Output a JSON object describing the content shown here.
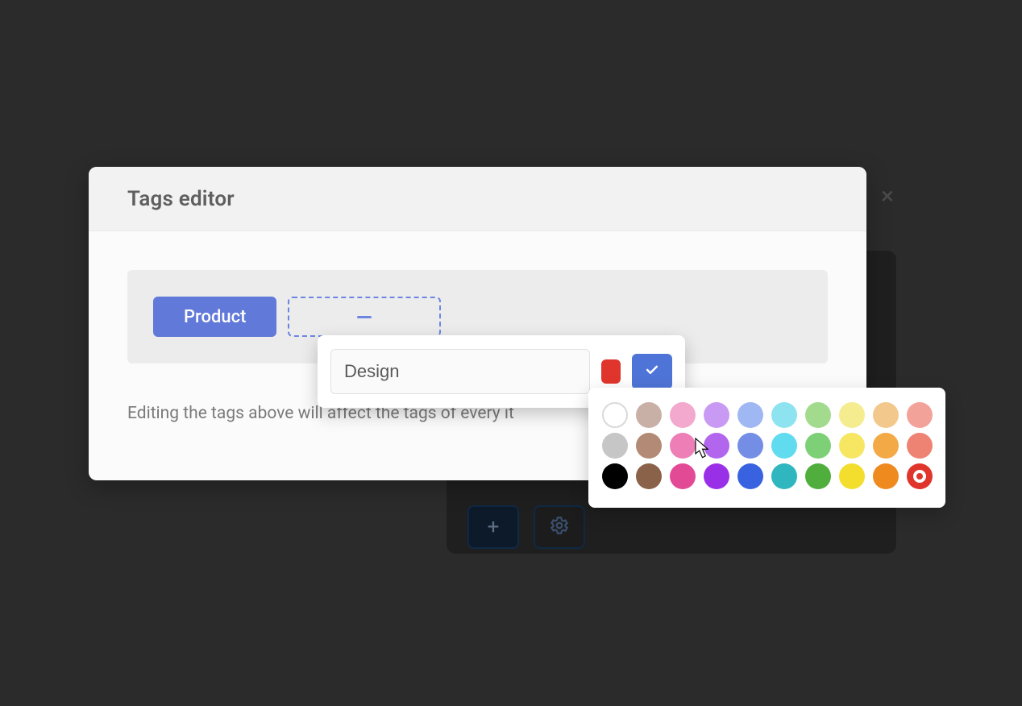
{
  "modal": {
    "title": "Tags editor",
    "existing_tag": "Product",
    "placeholder_label": "",
    "hint": "Editing the tags above will affect the tags of every it"
  },
  "tag_editor": {
    "input_value": "Design",
    "selected_color": "#e0352c"
  },
  "palette": {
    "rows": [
      [
        "outline",
        "#c9b0a6",
        "#f3a9cd",
        "#c99af3",
        "#9fb7f3",
        "#8de4f0",
        "#a2db8d",
        "#f4ec8e",
        "#f3c88d",
        "#f3a29a"
      ],
      [
        "#c6c6c6",
        "#b38a76",
        "#ed7eb6",
        "#b266ee",
        "#748ee6",
        "#60dbf0",
        "#7ed076",
        "#f6e662",
        "#f2a946",
        "#ee8273"
      ],
      [
        "#000000",
        "#8a6249",
        "#e24a95",
        "#9a2fe8",
        "#3862e0",
        "#2fb6be",
        "#4fae3c",
        "#f3de2e",
        "#ef8a1f",
        "target"
      ]
    ]
  },
  "behind": {
    "plus_label": "+",
    "gear_label": "⚙"
  }
}
